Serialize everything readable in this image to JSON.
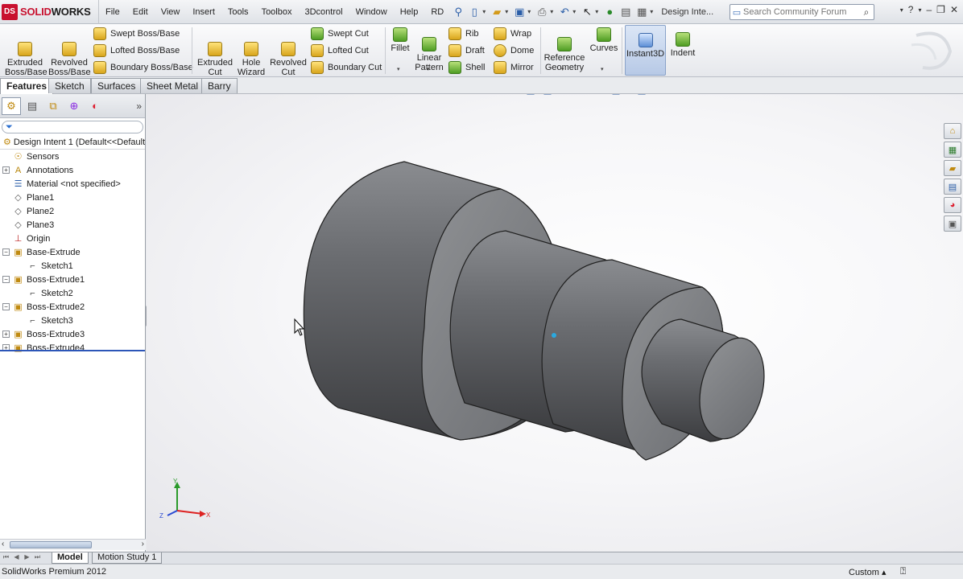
{
  "app": {
    "logo_text": "DS",
    "brand_name_part1": "SOLID",
    "brand_name_part2": "WORKS",
    "document_title": "Design Inte..."
  },
  "menu": [
    "File",
    "Edit",
    "View",
    "Insert",
    "Tools",
    "Toolbox",
    "3Dcontrol",
    "Window",
    "Help",
    "RD"
  ],
  "search": {
    "placeholder": "Search Community Forum"
  },
  "ribbon": {
    "extruded_boss": "Extruded\nBoss/Base",
    "revolved_boss": "Revolved\nBoss/Base",
    "swept_boss": "Swept Boss/Base",
    "lofted_boss": "Lofted Boss/Base",
    "boundary_boss": "Boundary Boss/Base",
    "extruded_cut": "Extruded\nCut",
    "hole_wizard": "Hole\nWizard",
    "revolved_cut": "Revolved\nCut",
    "swept_cut": "Swept Cut",
    "lofted_cut": "Lofted Cut",
    "boundary_cut": "Boundary Cut",
    "fillet": "Fillet",
    "linear_pattern": "Linear\nPattern",
    "rib": "Rib",
    "draft": "Draft",
    "shell": "Shell",
    "wrap": "Wrap",
    "dome": "Dome",
    "mirror": "Mirror",
    "reference_geometry": "Reference\nGeometry",
    "curves": "Curves",
    "instant3d": "Instant3D",
    "indent": "Indent"
  },
  "tabs": [
    "Features",
    "Sketch",
    "Surfaces",
    "Sheet Metal",
    "Barry"
  ],
  "feature_tree": {
    "root": "Design Intent 1  (Default<<Default",
    "items": [
      {
        "label": "Sensors",
        "icon": "sensor-icon",
        "expander": ""
      },
      {
        "label": "Annotations",
        "icon": "annotations-icon",
        "expander": "+"
      },
      {
        "label": "Material <not specified>",
        "icon": "material-icon",
        "expander": ""
      },
      {
        "label": "Plane1",
        "icon": "plane-icon",
        "expander": ""
      },
      {
        "label": "Plane2",
        "icon": "plane-icon",
        "expander": ""
      },
      {
        "label": "Plane3",
        "icon": "plane-icon",
        "expander": ""
      },
      {
        "label": "Origin",
        "icon": "origin-icon",
        "expander": ""
      },
      {
        "label": "Base-Extrude",
        "icon": "extrude-icon",
        "expander": "−"
      },
      {
        "label": "Sketch1",
        "icon": "sketch-icon",
        "expander": "",
        "child": true
      },
      {
        "label": "Boss-Extrude1",
        "icon": "extrude-icon",
        "expander": "−"
      },
      {
        "label": "Sketch2",
        "icon": "sketch-icon",
        "expander": "",
        "child": true
      },
      {
        "label": "Boss-Extrude2",
        "icon": "extrude-icon",
        "expander": "−"
      },
      {
        "label": "Sketch3",
        "icon": "sketch-icon",
        "expander": "",
        "child": true
      },
      {
        "label": "Boss-Extrude3",
        "icon": "extrude-icon",
        "expander": "+"
      },
      {
        "label": "Boss-Extrude4",
        "icon": "extrude-icon",
        "expander": "+"
      }
    ]
  },
  "triad": {
    "x": "X",
    "y": "Y",
    "z": "Z"
  },
  "bottom_tabs": [
    "Model",
    "Motion Study 1"
  ],
  "status": {
    "product": "SolidWorks Premium 2012",
    "units": "Custom"
  },
  "colors": {
    "accent_red": "#c8102e",
    "rollback_blue": "#2d56b8",
    "feature_yellow": "#e8b628"
  }
}
